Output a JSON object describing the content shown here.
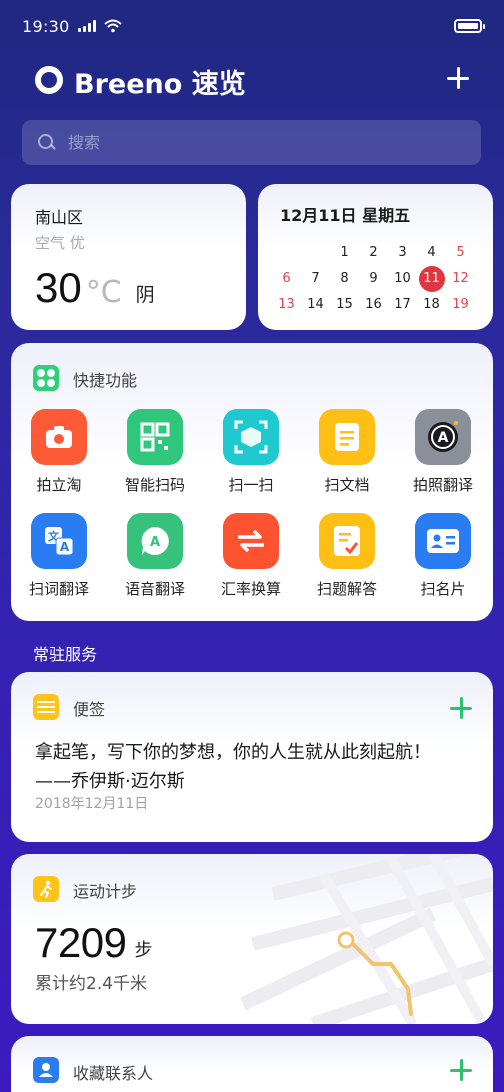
{
  "status_bar": {
    "time": "19:30"
  },
  "header": {
    "title": "Breeno 速览"
  },
  "search": {
    "placeholder": "搜索"
  },
  "weather": {
    "location": "南山区",
    "air_quality": "空气 优",
    "temperature": "30",
    "unit": "°C",
    "condition": "阴"
  },
  "calendar": {
    "date_label": "12月11日  星期五",
    "today": "11",
    "rows": [
      [
        "",
        "",
        "1",
        "2",
        "3",
        "4",
        "5"
      ],
      [
        "6",
        "7",
        "8",
        "9",
        "10",
        "11",
        "12"
      ],
      [
        "13",
        "14",
        "15",
        "16",
        "17",
        "18",
        "19"
      ]
    ]
  },
  "quick_functions": {
    "title": "快捷功能",
    "items": [
      {
        "label": "拍立淘",
        "color": "#ff5a36"
      },
      {
        "label": "智能扫码",
        "color": "#2fc77c"
      },
      {
        "label": "扫一扫",
        "color": "#1ec9cf"
      },
      {
        "label": "扫文档",
        "color": "#ffbf14"
      },
      {
        "label": "拍照翻译",
        "color": "#8a8f99"
      },
      {
        "label": "扫词翻译",
        "color": "#2a7cf2"
      },
      {
        "label": "语音翻译",
        "color": "#36c27a"
      },
      {
        "label": "汇率换算",
        "color": "#ff5230"
      },
      {
        "label": "扫题解答",
        "color": "#ffbf14"
      },
      {
        "label": "扫名片",
        "color": "#2a7cf2"
      }
    ]
  },
  "services": {
    "section_title": "常驻服务"
  },
  "notes": {
    "title": "便签",
    "line1": "拿起笔，写下你的梦想，你的人生就从此刻起航！",
    "line2": "——乔伊斯·迈尔斯",
    "date": "2018年12月11日"
  },
  "sport": {
    "title": "运动计步",
    "steps": "7209",
    "steps_unit": "步",
    "distance": "累计约2.4千米"
  },
  "contacts": {
    "title": "收藏联系人"
  }
}
